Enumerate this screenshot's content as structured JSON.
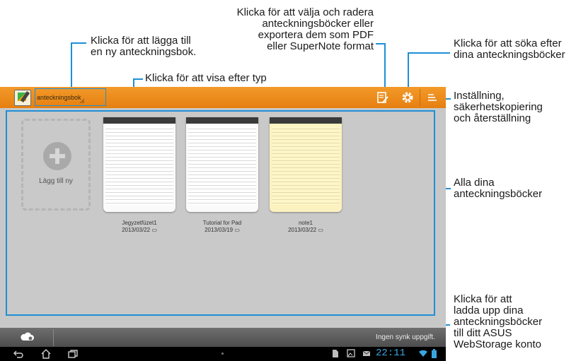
{
  "callouts": {
    "add_notebook": "Klicka för att lägga till\nen ny anteckningsbok.",
    "view_by_type": "Klicka för att visa efter typ",
    "select_delete_export": "Klicka för att välja och radera\nanteckningsböcker eller\nexportera dem som PDF\neller SuperNote format",
    "search": "Klicka för att söka efter\ndina anteckningsböcker",
    "settings": "Inställning,\nsäkerhetskopiering\noch återställning",
    "all_notebooks": "Alla dina\nanteckningsböcker",
    "upload": "Klicka för att\nladda upp dina\nanteckningsböcker\ntill ditt ASUS\nWebStorage konto"
  },
  "topbar": {
    "type_selector": "anteckningsbok",
    "icons": [
      "edit-icon",
      "gear-icon",
      "menu-icon"
    ]
  },
  "main": {
    "add_new_label": "Lägg till ny",
    "notebooks": [
      {
        "title": "Jegyzetfüzet1",
        "date": "2013/03/22",
        "paper": "white"
      },
      {
        "title": "Tutorial for Pad",
        "date": "2013/03/19",
        "paper": "white"
      },
      {
        "title": "note1",
        "date": "2013/03/22",
        "paper": "yellow"
      }
    ]
  },
  "bottombar": {
    "sync_status": "Ingen synk uppgift."
  },
  "navbar": {
    "clock": "22:11"
  },
  "colors": {
    "accent": "#1e8fd6",
    "toolbar_orange": "#ef8d1f",
    "clock_blue": "#3aa6e0"
  }
}
